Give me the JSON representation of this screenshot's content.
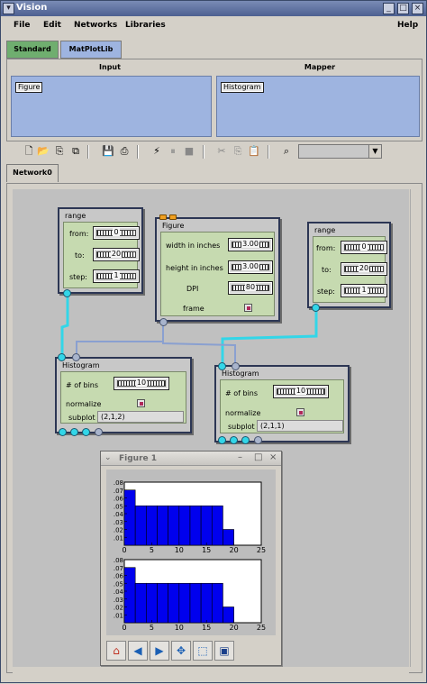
{
  "window": {
    "title": "Vision"
  },
  "menu": [
    "File",
    "Edit",
    "Networks",
    "Libraries",
    "Help"
  ],
  "library_tabs": [
    {
      "label": "Standard",
      "color": "#6fae6f"
    },
    {
      "label": "MatPlotLib",
      "color": "#9eb4e0"
    }
  ],
  "panels": {
    "input": {
      "header": "Input",
      "items": [
        "Figure"
      ]
    },
    "mapper": {
      "header": "Mapper",
      "items": [
        "Histogram"
      ]
    }
  },
  "toolbar": {
    "icons": [
      "new-file-icon",
      "open-folder-icon",
      "save-as-icon",
      "export-icon",
      "save-icon",
      "print-icon",
      "run-icon",
      "pause-icon",
      "stop-icon",
      "cut-icon",
      "copy-icon",
      "paste-icon",
      "binoculars-icon"
    ],
    "zoom_value": ""
  },
  "network_tab": "Network0",
  "modules": {
    "range1": {
      "title": "range",
      "from_label": "from:",
      "from": "0",
      "to_label": "to:",
      "to": "20",
      "step_label": "step:",
      "step": "1"
    },
    "figure": {
      "title": "Figure",
      "width_label": "width in inches",
      "width": "3.00",
      "height_label": "height in inches",
      "height": "3.00",
      "dpi_label": "DPI",
      "dpi": "80",
      "frame_label": "frame"
    },
    "range2": {
      "title": "range",
      "from_label": "from:",
      "from": "0",
      "to_label": "to:",
      "to": "20",
      "step_label": "step:",
      "step": "1"
    },
    "hist1": {
      "title": "Histogram",
      "bins_label": "# of bins",
      "bins": "10",
      "normalize_label": "normalize",
      "subplot_label": "subplot",
      "subplot": "(2,1,2)"
    },
    "hist2": {
      "title": "Histogram",
      "bins_label": "# of bins",
      "bins": "10",
      "normalize_label": "normalize",
      "subplot_label": "subplot",
      "subplot": "(2,1,1)"
    }
  },
  "figure_window": {
    "title": "Figure 1",
    "tools": [
      "home-icon",
      "back-icon",
      "forward-icon",
      "pan-icon",
      "zoom-icon",
      "save-icon"
    ]
  },
  "chart_data": [
    {
      "type": "bar",
      "title": "",
      "x": [
        0,
        2,
        4,
        6,
        8,
        10,
        12,
        14,
        16,
        18
      ],
      "bar_width": 2,
      "values": [
        0.07,
        0.05,
        0.05,
        0.05,
        0.05,
        0.05,
        0.05,
        0.05,
        0.05,
        0.02
      ],
      "xlim": [
        0,
        25
      ],
      "ylim": [
        0,
        0.08
      ],
      "xticks": [
        "0",
        "5",
        "10",
        "15",
        "20",
        "25"
      ],
      "yticks": [
        ".08",
        ".07",
        ".06",
        ".05",
        ".04",
        ".03",
        ".02",
        ".01"
      ],
      "bar_color": "#0000ee"
    },
    {
      "type": "bar",
      "title": "",
      "x": [
        0,
        2,
        4,
        6,
        8,
        10,
        12,
        14,
        16,
        18
      ],
      "bar_width": 2,
      "values": [
        0.07,
        0.05,
        0.05,
        0.05,
        0.05,
        0.05,
        0.05,
        0.05,
        0.05,
        0.02
      ],
      "xlim": [
        0,
        25
      ],
      "ylim": [
        0,
        0.08
      ],
      "xticks": [
        "0",
        "5",
        "10",
        "15",
        "20",
        "25"
      ],
      "yticks": [
        ".08",
        ".07",
        ".06",
        ".05",
        ".04",
        ".03",
        ".02",
        ".01"
      ],
      "bar_color": "#0000ee"
    }
  ],
  "colors": {
    "wire": "#33d6e8",
    "wire_grey": "#8aa0d0",
    "module_inner": "#c6dab0"
  }
}
